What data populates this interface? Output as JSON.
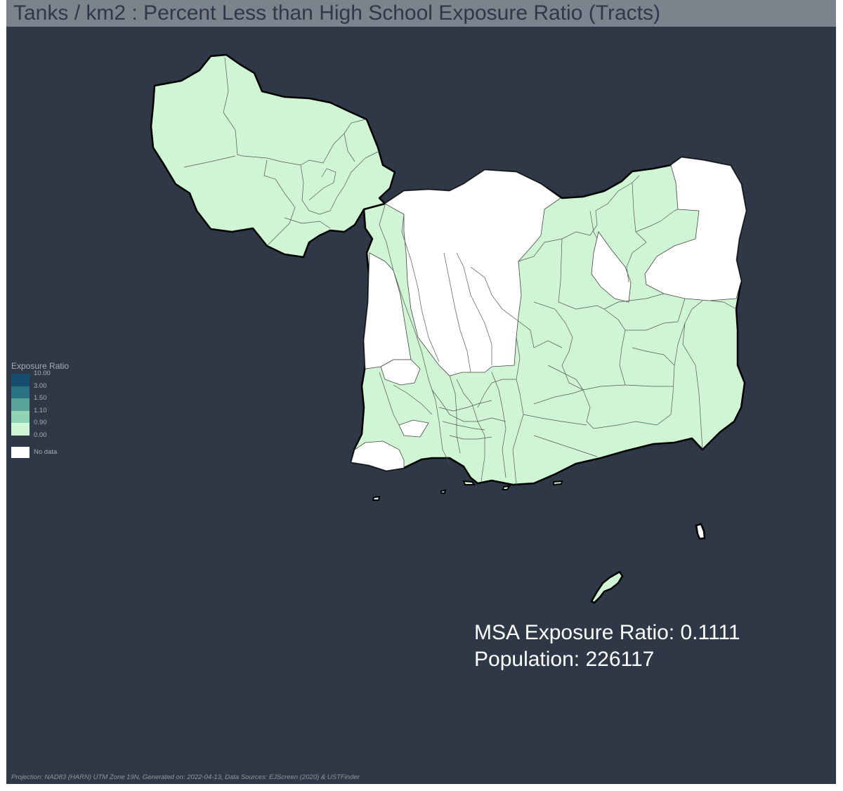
{
  "title": "Tanks / km2 : Percent Less than High School Exposure Ratio (Tracts)",
  "legend": {
    "title": "Exposure Ratio",
    "classes": [
      {
        "label": "10.00",
        "color": "#154e6e"
      },
      {
        "label": "3.00",
        "color": "#2b7184"
      },
      {
        "label": "1.50",
        "color": "#5aa39b"
      },
      {
        "label": "1.10",
        "color": "#90d4b5"
      },
      {
        "label": "0.90",
        "color": "#d0f5d5"
      }
    ],
    "bottom_label": "0.00",
    "no_data_label": "No data",
    "no_data_color": "#ffffff"
  },
  "stats": {
    "exposure_ratio": "MSA Exposure Ratio: 0.1111",
    "population": "Population: 226117"
  },
  "footer": "Projection: NAD83 (HARN) UTM Zone 19N, Generated on: 2022-04-13, Data Sources: EJScreen (2020) & USTFinder",
  "colors": {
    "background": "#2e3847",
    "title_bar": "#7d838c",
    "tract_fill": "#d0f5d5",
    "no_data": "#ffffff",
    "boundary": "#000000"
  }
}
